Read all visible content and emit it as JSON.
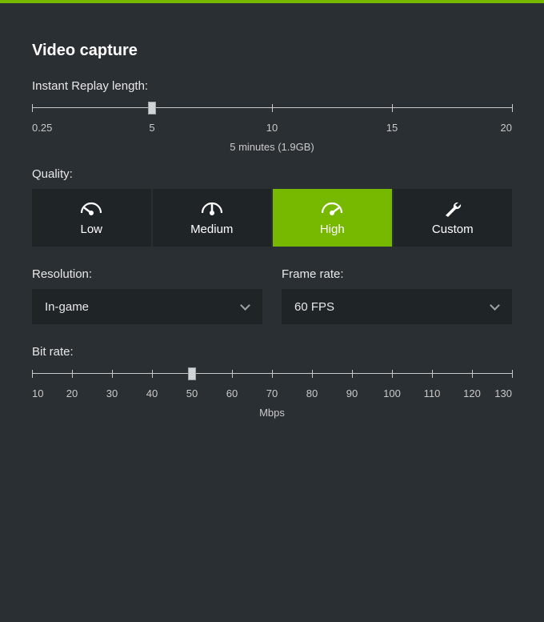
{
  "panel": {
    "title": "Video capture",
    "replay": {
      "label": "Instant Replay length:",
      "ticks": [
        "0.25",
        "5",
        "10",
        "15",
        "20"
      ],
      "value": 5,
      "caption": "5 minutes (1.9GB)"
    },
    "quality": {
      "label": "Quality:",
      "options": [
        {
          "label": "Low",
          "icon": "gauge-low-icon"
        },
        {
          "label": "Medium",
          "icon": "gauge-mid-icon"
        },
        {
          "label": "High",
          "icon": "gauge-high-icon"
        },
        {
          "label": "Custom",
          "icon": "wrench-icon"
        }
      ],
      "selected": "High"
    },
    "resolution": {
      "label": "Resolution:",
      "value": "In-game"
    },
    "framerate": {
      "label": "Frame rate:",
      "value": "60 FPS"
    },
    "bitrate": {
      "label": "Bit rate:",
      "ticks": [
        "10",
        "20",
        "30",
        "40",
        "50",
        "60",
        "70",
        "80",
        "90",
        "100",
        "110",
        "120",
        "130"
      ],
      "value": 50,
      "unit": "Mbps"
    }
  }
}
